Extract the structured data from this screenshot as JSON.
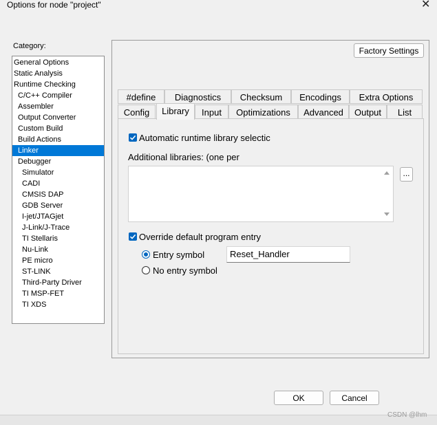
{
  "window": {
    "title": "Options for node \"project\"",
    "close_glyph": "✕"
  },
  "category": {
    "label": "Category:",
    "selected": "Linker",
    "items": [
      "General Options",
      "Static Analysis",
      "Runtime Checking",
      "C/C++ Compiler",
      "Assembler",
      "Output Converter",
      "Custom Build",
      "Build Actions",
      "Linker",
      "Debugger",
      "Simulator",
      "CADI",
      "CMSIS DAP",
      "GDB Server",
      "I-jet/JTAGjet",
      "J-Link/J-Trace",
      "TI Stellaris",
      "Nu-Link",
      "PE micro",
      "ST-LINK",
      "Third-Party Driver",
      "TI MSP-FET",
      "TI XDS"
    ]
  },
  "factory_settings_label": "Factory Settings",
  "tabs": {
    "row1": [
      "#define",
      "Diagnostics",
      "Checksum",
      "Encodings",
      "Extra Options"
    ],
    "row2": [
      "Config",
      "Library",
      "Input",
      "Optimizations",
      "Advanced",
      "Output",
      "List"
    ],
    "active": "Library"
  },
  "library": {
    "auto_runtime_label": "Automatic runtime library selectic",
    "auto_runtime_checked": true,
    "additional_libraries_label": "Additional libraries: (one per",
    "browse_label": "...",
    "override_entry_label": "Override default program entry",
    "override_entry_checked": true,
    "entry_symbol_label": "Entry symbol",
    "entry_symbol_value": "Reset_Handler",
    "no_entry_label": "No entry symbol",
    "selected_option": "Entry symbol"
  },
  "buttons": {
    "ok": "OK",
    "cancel": "Cancel"
  },
  "watermark": "CSDN @lhm"
}
